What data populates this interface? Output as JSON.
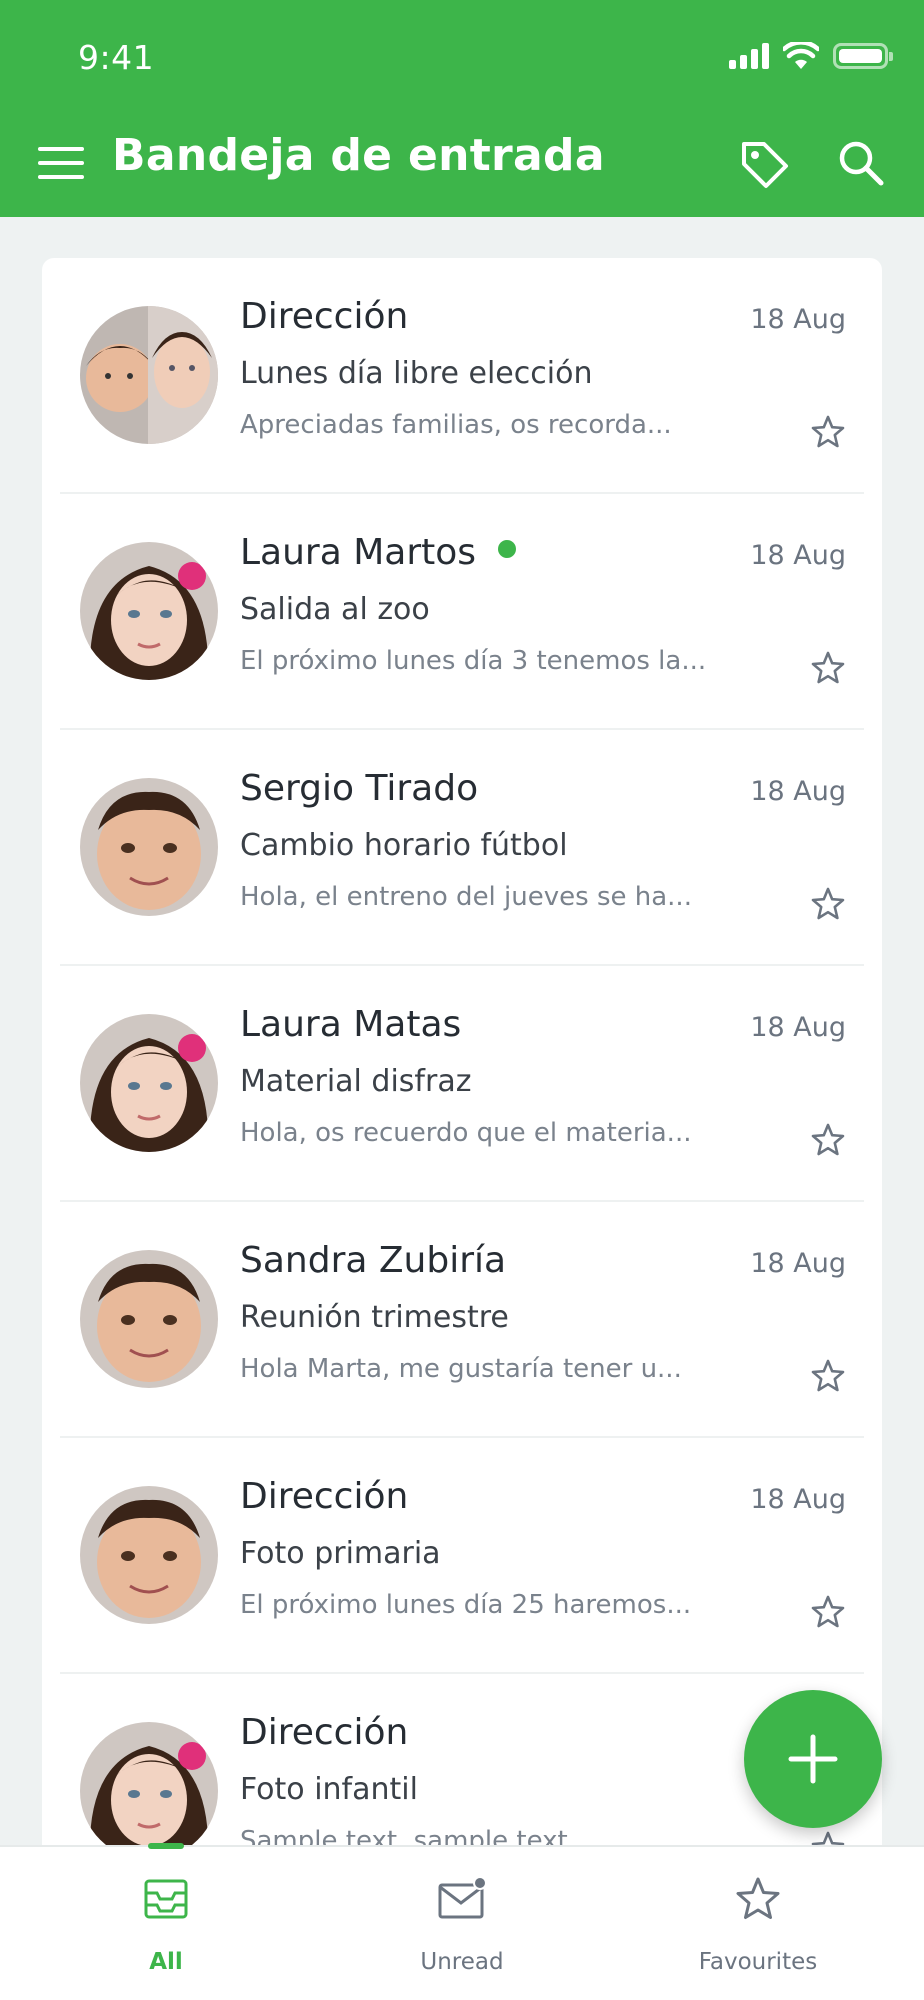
{
  "status_bar": {
    "time": "9:41"
  },
  "header": {
    "title": "Bandeja de entrada",
    "menu_icon": "menu-icon",
    "tag_icon": "tag-icon",
    "search_icon": "search-icon"
  },
  "colors": {
    "accent": "#3db54a",
    "online": "#3db54a"
  },
  "messages": [
    {
      "sender": "Dirección",
      "date": "18 Aug",
      "subject": "Lunes día libre elección",
      "preview": "Apreciadas familias, os recorda...",
      "online": false,
      "avatar": "two-children"
    },
    {
      "sender": "Laura Martos",
      "date": "18 Aug",
      "subject": "Salida al zoo",
      "preview": "El próximo lunes día 3 tenemos la...",
      "online": true,
      "avatar": "girl"
    },
    {
      "sender": "Sergio Tirado",
      "date": "18 Aug",
      "subject": "Cambio horario fútbol",
      "preview": "Hola, el entreno del jueves se ha...",
      "online": false,
      "avatar": "boy"
    },
    {
      "sender": "Laura Matas",
      "date": "18 Aug",
      "subject": "Material disfraz",
      "preview": "Hola, os recuerdo que el materia...",
      "online": false,
      "avatar": "girl"
    },
    {
      "sender": "Sandra Zubiría",
      "date": "18 Aug",
      "subject": "Reunión trimestre",
      "preview": "Hola Marta, me gustaría tener u...",
      "online": false,
      "avatar": "boy"
    },
    {
      "sender": "Dirección",
      "date": "18 Aug",
      "subject": "Foto primaria",
      "preview": "El próximo lunes día 25 haremos...",
      "online": false,
      "avatar": "boy"
    },
    {
      "sender": "Dirección",
      "date": "",
      "subject": "Foto infantil",
      "preview": "Sample text, sample text",
      "online": false,
      "avatar": "girl"
    }
  ],
  "fab": {
    "icon": "plus-icon"
  },
  "bottom_nav": [
    {
      "label": "All",
      "icon": "inbox-icon",
      "active": true
    },
    {
      "label": "Unread",
      "icon": "envelope-icon",
      "active": false
    },
    {
      "label": "Favourites",
      "icon": "star-icon",
      "active": false
    }
  ]
}
